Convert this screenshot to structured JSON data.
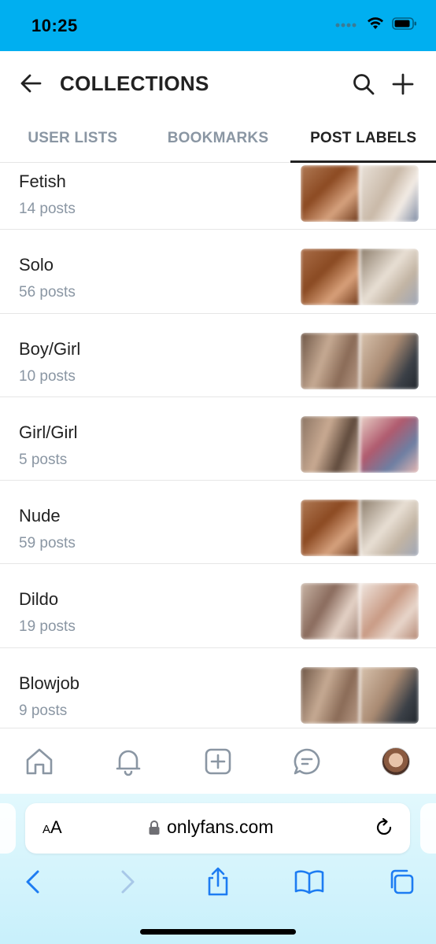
{
  "status_bar": {
    "time": "10:25"
  },
  "header": {
    "title": "COLLECTIONS"
  },
  "tabs": [
    {
      "label": "USER LISTS",
      "active": false
    },
    {
      "label": "BOOKMARKS",
      "active": false
    },
    {
      "label": "POST LABELS",
      "active": true
    }
  ],
  "labels": [
    {
      "name": "Fetish",
      "count": "14 posts"
    },
    {
      "name": "Solo",
      "count": "56 posts"
    },
    {
      "name": "Boy/Girl",
      "count": "10 posts"
    },
    {
      "name": "Girl/Girl",
      "count": "5 posts"
    },
    {
      "name": "Nude",
      "count": "59 posts"
    },
    {
      "name": "Dildo",
      "count": "19 posts"
    },
    {
      "name": "Blowjob",
      "count": "9 posts"
    }
  ],
  "bottom_nav": [
    "home-icon",
    "bell-icon",
    "plus-square-icon",
    "chat-icon",
    "avatar"
  ],
  "browser": {
    "text_size_label_small": "A",
    "text_size_label_large": "A",
    "url": "onlyfans.com"
  },
  "colors": {
    "accent": "#00aff0",
    "muted": "#8a96a3",
    "icon": "#8a96a3",
    "safari_blue": "#1d7cf2"
  }
}
